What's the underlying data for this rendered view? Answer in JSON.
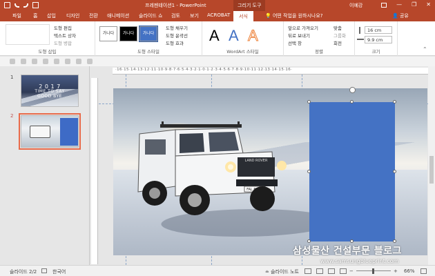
{
  "title_bar": {
    "document_title": "프레젠테이션1  -  PowerPoint",
    "context_tab_group": "그리기 도구",
    "user_name": "이예강",
    "minimize": "—",
    "restore": "❐",
    "close": "✕"
  },
  "tabs": {
    "items": [
      "파일",
      "홈",
      "삽입",
      "디자인",
      "전환",
      "애니메이션",
      "슬라이드 쇼",
      "검토",
      "보기",
      "ACROBAT"
    ],
    "active": "서식",
    "tell_me": "어떤 작업을 원하시나요?",
    "share": "공유"
  },
  "ribbon": {
    "insert_shapes": {
      "edit_shape": "도형 편집",
      "text_box": "텍스트 상자",
      "merge_shapes": "도형 병합",
      "label": "도형 삽입"
    },
    "shape_styles": {
      "swatch_1": "가나다",
      "swatch_2": "가나다",
      "swatch_3": "가나다",
      "fill": "도형 채우기",
      "outline": "도형 윤곽선",
      "effects": "도형 효과",
      "label": "도형 스타일"
    },
    "wordart": {
      "letter": "A",
      "label": "WordArt 스타일"
    },
    "arrange": {
      "bring_forward": "앞으로 가져오기",
      "send_backward": "뒤로 보내기",
      "selection_pane": "선택 창",
      "align": "맞춤",
      "group": "그룹화",
      "rotate": "회전",
      "label": "정렬"
    },
    "size": {
      "height": "16 cm",
      "width": "9.9 cm",
      "label": "크기"
    }
  },
  "slides_panel": {
    "slide_1_number": "1",
    "slide_1_line1": "2 0 1 7",
    "slide_1_line2": "TIME TO SAY",
    "slide_1_line3": "GOOD BYE",
    "slide_2_number": "2"
  },
  "ruler": {
    "horizontal": "·16·15·14·13·12·11·10·9·8·7·6·5·4·3·2·1·0·1·2·3·4·5·6·7·8·9·10·11·12·13·14·15·16·"
  },
  "slide": {
    "car_plate": "FAL 8HR2",
    "car_badge": "LAND ROVER",
    "rect_color": "#4472c4"
  },
  "watermark": {
    "title": "삼성물산 건설부문 블로그",
    "url": "www.samsungblueprint.com"
  },
  "status_bar": {
    "slide_counter": "슬라이드 2/2",
    "language": "한국어",
    "notes": "슬라이드 노트",
    "zoom": "66%"
  },
  "colors": {
    "accent": "#b7472a",
    "selection_outline": "#e86a49",
    "shape_fill": "#4472c4"
  }
}
